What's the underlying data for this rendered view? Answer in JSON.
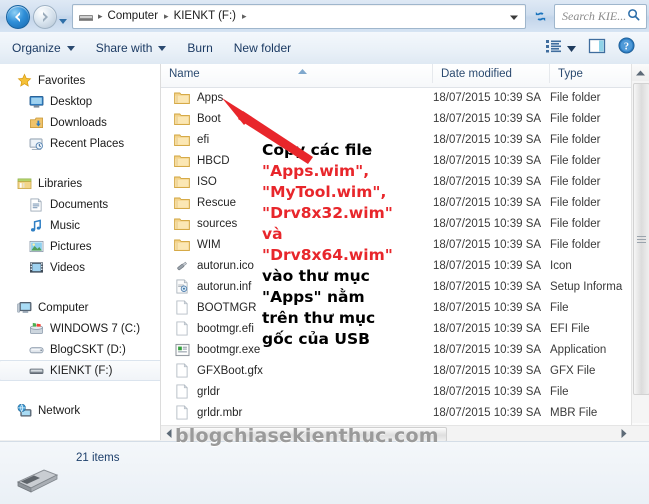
{
  "window": {
    "title": "KIENKT (F:)",
    "back_tooltip": "Back",
    "forward_tooltip": "Forward",
    "history_tooltip": "Recent pages"
  },
  "address": {
    "drive_icon": "usb-drive-icon",
    "crumbs": [
      "Computer",
      "KIENKT (F:)"
    ],
    "separator": "▸",
    "dropdown_icon": "chevron-down-icon",
    "refresh_icon": "refresh-icon"
  },
  "search": {
    "placeholder": "Search KIE...",
    "icon": "search-icon"
  },
  "toolbar": {
    "organize": "Organize",
    "share_with": "Share with",
    "burn": "Burn",
    "new_folder": "New folder",
    "views_icon": "view-list-icon",
    "views_caret_icon": "chevron-down-icon",
    "preview_icon": "preview-pane-icon",
    "help_icon": "help-icon"
  },
  "navpane": {
    "groups": [
      {
        "header": {
          "label": "Favorites",
          "icon": "star-icon"
        },
        "items": [
          {
            "label": "Desktop",
            "icon": "desktop-icon"
          },
          {
            "label": "Downloads",
            "icon": "downloads-icon"
          },
          {
            "label": "Recent Places",
            "icon": "recent-places-icon"
          }
        ]
      },
      {
        "header": {
          "label": "Libraries",
          "icon": "libraries-icon"
        },
        "items": [
          {
            "label": "Documents",
            "icon": "documents-icon"
          },
          {
            "label": "Music",
            "icon": "music-icon"
          },
          {
            "label": "Pictures",
            "icon": "pictures-icon"
          },
          {
            "label": "Videos",
            "icon": "videos-icon"
          }
        ]
      },
      {
        "header": {
          "label": "Computer",
          "icon": "computer-icon"
        },
        "items": [
          {
            "label": "WINDOWS 7 (C:)",
            "icon": "system-drive-icon",
            "selected": false
          },
          {
            "label": "BlogCSKT (D:)",
            "icon": "hard-drive-icon",
            "selected": false
          },
          {
            "label": "KIENKT (F:)",
            "icon": "usb-drive-icon",
            "selected": true
          }
        ]
      },
      {
        "header": {
          "label": "Network",
          "icon": "network-icon"
        },
        "items": []
      }
    ]
  },
  "filelist": {
    "columns": [
      "Name",
      "Date modified",
      "Type"
    ],
    "sort_column": "Name",
    "sort_direction": "ascending",
    "rows": [
      {
        "name": "Apps",
        "icon": "folder-icon",
        "date": "18/07/2015 10:39 SA",
        "type": "File folder"
      },
      {
        "name": "Boot",
        "icon": "folder-icon",
        "date": "18/07/2015 10:39 SA",
        "type": "File folder"
      },
      {
        "name": "efi",
        "icon": "folder-icon",
        "date": "18/07/2015 10:39 SA",
        "type": "File folder"
      },
      {
        "name": "HBCD",
        "icon": "folder-icon",
        "date": "18/07/2015 10:39 SA",
        "type": "File folder"
      },
      {
        "name": "ISO",
        "icon": "folder-icon",
        "date": "18/07/2015 10:39 SA",
        "type": "File folder"
      },
      {
        "name": "Rescue",
        "icon": "folder-icon",
        "date": "18/07/2015 10:39 SA",
        "type": "File folder"
      },
      {
        "name": "sources",
        "icon": "folder-icon",
        "date": "18/07/2015 10:39 SA",
        "type": "File folder"
      },
      {
        "name": "WIM",
        "icon": "folder-icon",
        "date": "18/07/2015 10:39 SA",
        "type": "File folder"
      },
      {
        "name": "autorun.ico",
        "icon": "icon-file-icon",
        "date": "18/07/2015 10:39 SA",
        "type": "Icon"
      },
      {
        "name": "autorun.inf",
        "icon": "setup-info-icon",
        "date": "18/07/2015 10:39 SA",
        "type": "Setup Informa"
      },
      {
        "name": "BOOTMGR",
        "icon": "generic-file-icon",
        "date": "18/07/2015 10:39 SA",
        "type": "File"
      },
      {
        "name": "bootmgr.efi",
        "icon": "generic-file-icon",
        "date": "18/07/2015 10:39 SA",
        "type": "EFI File"
      },
      {
        "name": "bootmgr.exe",
        "icon": "application-icon",
        "date": "18/07/2015 10:39 SA",
        "type": "Application"
      },
      {
        "name": "GFXBoot.gfx",
        "icon": "generic-file-icon",
        "date": "18/07/2015 10:39 SA",
        "type": "GFX File"
      },
      {
        "name": "grldr",
        "icon": "generic-file-icon",
        "date": "18/07/2015 10:39 SA",
        "type": "File"
      },
      {
        "name": "grldr.mbr",
        "icon": "generic-file-icon",
        "date": "18/07/2015 10:39 SA",
        "type": "MBR File"
      }
    ]
  },
  "statusbar": {
    "item_count": "21 items",
    "drive_icon": "usb-drive-icon"
  },
  "annotation": {
    "arrow": "red-arrow-pointing-to-apps-folder",
    "arrow_color": "#E8262B",
    "lines": [
      {
        "text": "Copy các file",
        "color": "black"
      },
      {
        "text": "\"Apps.wim\",",
        "color": "red"
      },
      {
        "text": "\"MyTool.wim\",",
        "color": "red"
      },
      {
        "text": "\"Drv8x32.wim\"",
        "color": "red"
      },
      {
        "text": "và",
        "color": "red"
      },
      {
        "text": "\"Drv8x64.wim\"",
        "color": "red"
      },
      {
        "text": "vào thư mục",
        "color": "black"
      },
      {
        "text": "\"Apps\" nằm",
        "color": "black"
      },
      {
        "text": "trên thư mục",
        "color": "black"
      },
      {
        "text": "gốc của USB",
        "color": "black"
      }
    ]
  },
  "watermark": {
    "text": "blogchiasekienthuc.com"
  }
}
